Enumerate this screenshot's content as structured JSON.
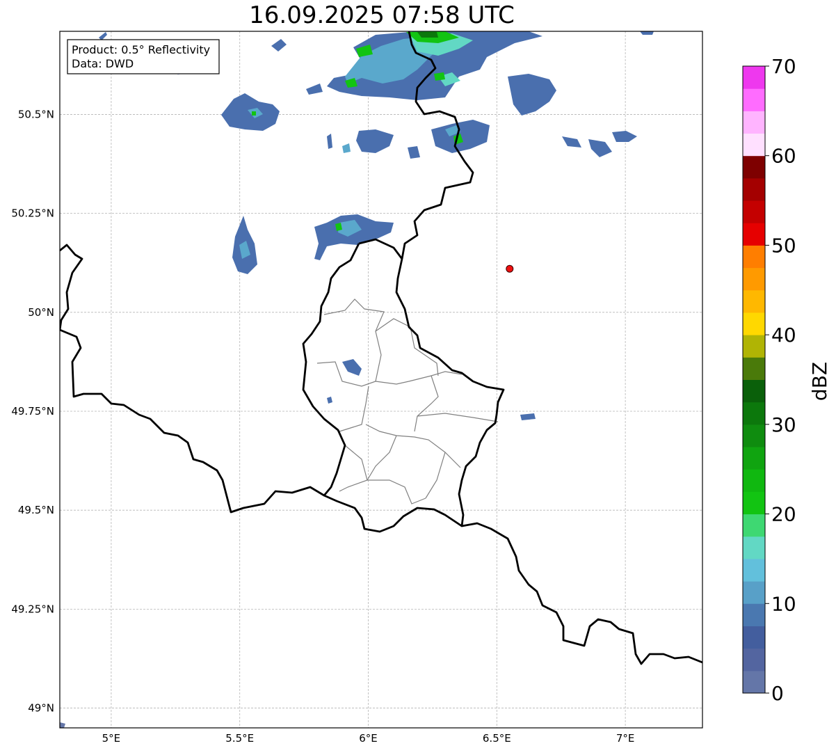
{
  "title": "16.09.2025 07:58 UTC",
  "info_box": {
    "line1": "Product: 0.5° Reflectivity",
    "line2": "Data: DWD"
  },
  "map": {
    "lon_range": [
      4.8,
      7.3
    ],
    "lat_range": [
      48.95,
      50.71
    ],
    "x_ticks": [
      {
        "value": 5.0,
        "label": "5°E"
      },
      {
        "value": 5.5,
        "label": "5.5°E"
      },
      {
        "value": 6.0,
        "label": "6°E"
      },
      {
        "value": 6.5,
        "label": "6.5°E"
      },
      {
        "value": 7.0,
        "label": "7°E"
      }
    ],
    "y_ticks": [
      {
        "value": 50.5,
        "label": "50.5°N"
      },
      {
        "value": 50.25,
        "label": "50.25°N"
      },
      {
        "value": 50.0,
        "label": "50°N"
      },
      {
        "value": 49.75,
        "label": "49.75°N"
      },
      {
        "value": 49.5,
        "label": "49.5°N"
      },
      {
        "value": 49.25,
        "label": "49.25°N"
      },
      {
        "value": 49.0,
        "label": "49°N"
      }
    ],
    "grid": true,
    "marker": {
      "lon": 6.55,
      "lat": 50.11,
      "color": "#ee1111"
    }
  },
  "colorbar": {
    "label": "dBZ",
    "min": 0,
    "max": 70,
    "step": 2.5,
    "tick_values": [
      0,
      10,
      20,
      30,
      40,
      50,
      60,
      70
    ],
    "tick_labels": [
      "0",
      "10",
      "20",
      "30",
      "40",
      "50",
      "60",
      "70"
    ],
    "colors": [
      "#6476a8",
      "#5365a0",
      "#435e9e",
      "#4a78b0",
      "#58a0c8",
      "#62c0dc",
      "#62d8c4",
      "#3ed872",
      "#12c412",
      "#10b810",
      "#10a410",
      "#0f8c0f",
      "#0c780c",
      "#0a600a",
      "#4a7a0a",
      "#b0b404",
      "#ffd800",
      "#ffb800",
      "#ff9a00",
      "#ff7e00",
      "#e60000",
      "#c40000",
      "#a40000",
      "#7e0000",
      "#ffe0ff",
      "#ffb4ff",
      "#ff6cff",
      "#ee38ee"
    ]
  }
}
